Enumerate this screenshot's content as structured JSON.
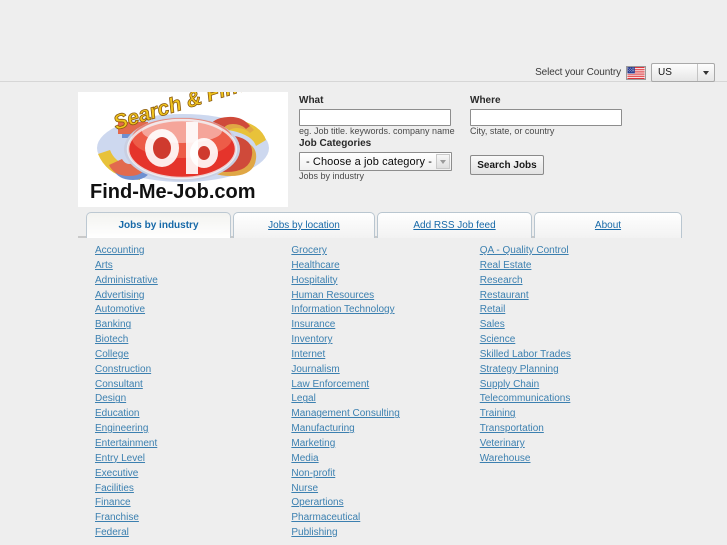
{
  "topbar": {
    "country_label": "Select your Country",
    "flag_icon": "us-flag-icon",
    "selected_country": "US"
  },
  "logo": {
    "tagline": "Search & Find",
    "wordmark": "Jobs",
    "domain": "Find-Me-Job.com"
  },
  "search_form": {
    "what_label": "What",
    "what_value": "",
    "what_placeholder": "",
    "what_hint": "eg. Job title. keywords. company name",
    "where_label": "Where",
    "where_value": "",
    "where_placeholder": "",
    "where_hint": "City, state, or country",
    "categories_label": "Job Categories",
    "categories_selected": "- Choose a job category -",
    "categories_hint": "Jobs by industry",
    "search_button": "Search Jobs"
  },
  "tabs": [
    {
      "label": "Jobs by industry",
      "active": true
    },
    {
      "label": "Jobs by location",
      "active": false
    },
    {
      "label": "Add RSS Job feed",
      "active": false
    },
    {
      "label": "About",
      "active": false
    }
  ],
  "categories": {
    "column1": [
      "Accounting",
      "Arts",
      "Administrative",
      "Advertising",
      "Automotive",
      "Banking",
      "Biotech",
      "College",
      "Construction",
      "Consultant",
      "Design",
      "Education",
      "Engineering",
      "Entertainment",
      "Entry Level",
      "Executive",
      "Facilities",
      "Finance",
      "Franchise",
      "Federal"
    ],
    "column2": [
      "Grocery",
      "Healthcare",
      "Hospitality",
      "Human Resources",
      "Information Technology",
      "Insurance",
      "Inventory",
      "Internet",
      "Journalism",
      "Law Enforcement",
      "Legal",
      "Management Consulting",
      "Manufacturing",
      "Marketing",
      "Media",
      "Non-profit",
      "Nurse",
      "Operartions",
      "Pharmaceutical",
      "Publishing"
    ],
    "column3": [
      "QA - Quality Control",
      "Real Estate",
      "Research",
      "Restaurant",
      "Retail",
      "Sales",
      "Science",
      "Skilled Labor Trades",
      "Strategy Planning",
      "Supply Chain",
      "Telecommunications",
      "Training",
      "Transportation",
      "Veterinary",
      "Warehouse"
    ]
  },
  "colors": {
    "page_background": "#eeeeee",
    "link_blue": "#3c80b0",
    "tab_blue": "#1769a8",
    "logo_red": "#d52b23",
    "logo_yellow": "#f2c200",
    "logo_blue": "#5b7fc7"
  }
}
